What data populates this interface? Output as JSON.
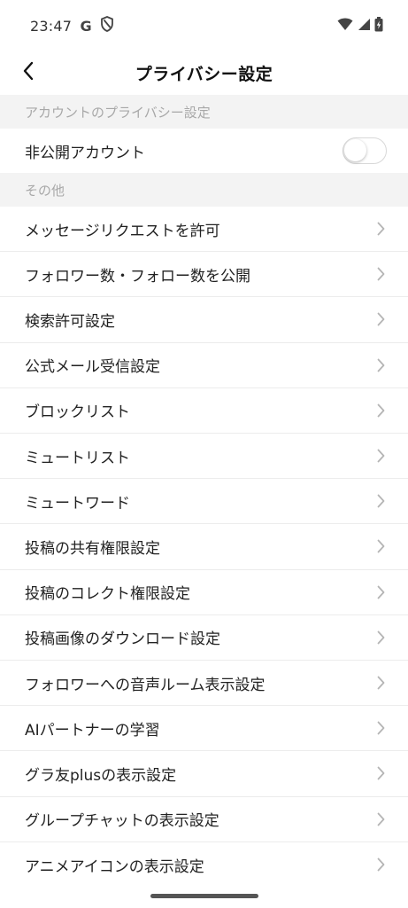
{
  "status_bar": {
    "time": "23:47",
    "icons": [
      "google-g-icon",
      "shield-icon",
      "wifi-icon",
      "cellular-signal-icon",
      "battery-charging-icon"
    ]
  },
  "header": {
    "title": "プライバシー設定",
    "back_icon": "chevron-left-icon"
  },
  "account_section": {
    "title": "アカウントのプライバシー設定",
    "private_account": {
      "label": "非公開アカウント",
      "enabled": false
    }
  },
  "other_section": {
    "title": "その他",
    "items": [
      {
        "label": "メッセージリクエストを許可"
      },
      {
        "label": "フォロワー数・フォロー数を公開"
      },
      {
        "label": "検索許可設定"
      },
      {
        "label": "公式メール受信設定"
      },
      {
        "label": "ブロックリスト"
      },
      {
        "label": "ミュートリスト"
      },
      {
        "label": "ミュートワード"
      },
      {
        "label": "投稿の共有権限設定"
      },
      {
        "label": "投稿のコレクト権限設定"
      },
      {
        "label": "投稿画像のダウンロード設定"
      },
      {
        "label": "フォロワーへの音声ルーム表示設定"
      },
      {
        "label": "AIパートナーの学習"
      },
      {
        "label": "グラ友plusの表示設定"
      },
      {
        "label": "グループチャットの表示設定"
      },
      {
        "label": "アニメアイコンの表示設定"
      }
    ]
  },
  "colors": {
    "section_bg": "#f3f3f3",
    "section_text": "#a8a8a8",
    "divider": "#ececec",
    "chevron": "#b5b5b5"
  }
}
